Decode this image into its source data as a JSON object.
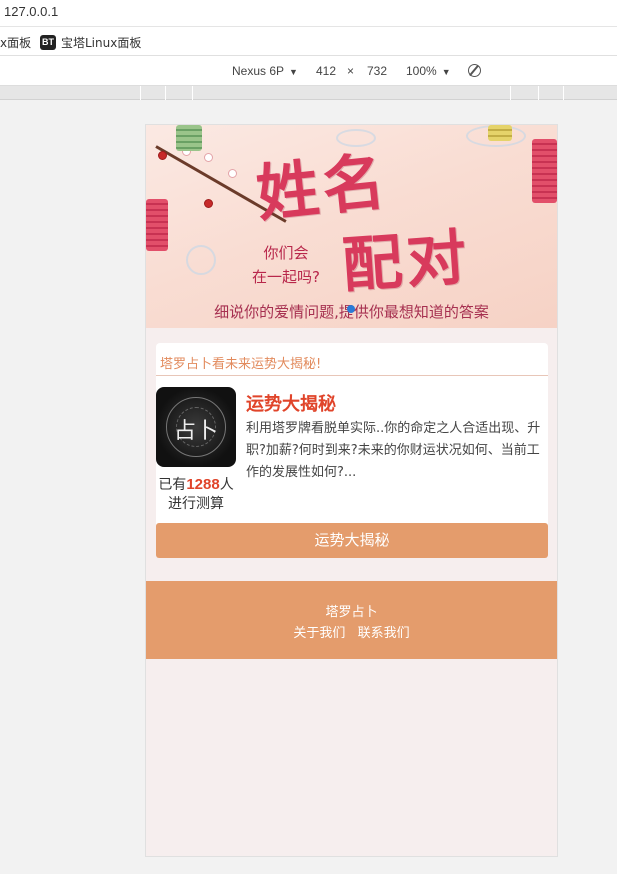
{
  "browser": {
    "url": "127.0.0.1",
    "bookmarks": [
      {
        "label": "x面板"
      },
      {
        "badge": "BT",
        "label": "宝塔Linux面板"
      }
    ],
    "device": {
      "name": "Nexus 6P",
      "width": "412",
      "times": "×",
      "height": "732",
      "zoom": "100%"
    }
  },
  "banner": {
    "title_line1": "姓名",
    "title_line2": "配对",
    "question_line1": "你们会",
    "question_line2": "在一起吗?",
    "subtitle": "细说你的爱情问题,提供你最想知道的答案"
  },
  "card": {
    "heading": "塔罗占卜看未来运势大揭秘!",
    "thumb_text": "占卜",
    "count_prefix": "已有",
    "count_num": "1288",
    "count_suffix": "人",
    "count_line2": "进行测算",
    "item_title": "运势大揭秘",
    "item_desc": "利用塔罗牌看脱单实际..你的命定之人合适出现、升职?加薪?何时到来?未来的你财运状况如何、当前工作的发展性如何?...",
    "button_label": "运势大揭秘"
  },
  "footer": {
    "brand": "塔罗占卜",
    "about": "关于我们",
    "contact": "联系我们"
  }
}
